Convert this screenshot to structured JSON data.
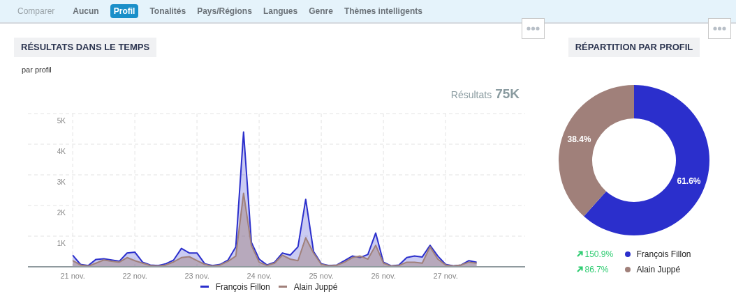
{
  "filter_bar": {
    "label": "Comparer",
    "tabs": [
      {
        "label": "Aucun",
        "selected": false
      },
      {
        "label": "Profil",
        "selected": true
      },
      {
        "label": "Tonalités",
        "selected": false
      },
      {
        "label": "Pays/Régions",
        "selected": false
      },
      {
        "label": "Langues",
        "selected": false
      },
      {
        "label": "Genre",
        "selected": false
      },
      {
        "label": "Thèmes intelligents",
        "selected": false
      }
    ]
  },
  "results_panel": {
    "title": "RÉSULTATS DANS LE TEMPS",
    "subtitle": "par profil",
    "total_label": "Résultats",
    "total_value": "75K",
    "chart_data": {
      "type": "area",
      "categories": [
        "21 nov.",
        null,
        null,
        null,
        null,
        null,
        null,
        null,
        "22 nov.",
        null,
        null,
        null,
        null,
        null,
        null,
        null,
        "23 nov.",
        null,
        null,
        null,
        null,
        null,
        null,
        null,
        "24 nov.",
        null,
        null,
        null,
        null,
        null,
        null,
        null,
        "25 nov.",
        null,
        null,
        null,
        null,
        null,
        null,
        null,
        "26 nov.",
        null,
        null,
        null,
        null,
        null,
        null,
        null,
        "27 nov.",
        null,
        null,
        null,
        null
      ],
      "series": [
        {
          "name": "François Fillon",
          "color": "#2b2fcc",
          "values": [
            380,
            80,
            40,
            240,
            260,
            220,
            180,
            450,
            480,
            150,
            60,
            40,
            100,
            220,
            600,
            450,
            450,
            100,
            40,
            80,
            220,
            650,
            4400,
            800,
            250,
            60,
            150,
            450,
            380,
            650,
            2200,
            500,
            100,
            40,
            60,
            200,
            350,
            300,
            400,
            1100,
            150,
            30,
            60,
            300,
            350,
            320,
            700,
            350,
            80,
            30,
            60,
            200,
            150
          ]
        },
        {
          "name": "Alain Juppé",
          "color": "#a0807a",
          "values": [
            200,
            60,
            20,
            120,
            220,
            180,
            150,
            300,
            200,
            120,
            40,
            20,
            60,
            160,
            300,
            330,
            200,
            80,
            20,
            60,
            180,
            350,
            2400,
            700,
            150,
            40,
            120,
            380,
            250,
            200,
            950,
            450,
            80,
            30,
            50,
            150,
            300,
            350,
            250,
            700,
            120,
            20,
            40,
            150,
            150,
            120,
            650,
            250,
            60,
            20,
            60,
            150,
            120
          ]
        }
      ],
      "grid": true,
      "ylim": [
        0,
        5000
      ],
      "yticks": [
        {
          "value": 1000,
          "label": "1K"
        },
        {
          "value": 2000,
          "label": "2K"
        },
        {
          "value": 3000,
          "label": "3K"
        },
        {
          "value": 4000,
          "label": "4K"
        },
        {
          "value": 5000,
          "label": "5K"
        }
      ]
    }
  },
  "profile_panel": {
    "title": "RÉPARTITION PAR PROFIL",
    "chart_data": {
      "type": "donut",
      "categories": [
        "François Fillon",
        "Alain Juppé"
      ],
      "values": [
        61.6,
        38.4
      ],
      "value_labels": [
        "61.6%",
        "38.4%"
      ]
    },
    "legend": [
      {
        "change": "150.9%",
        "color": "#2b2fcc"
      },
      {
        "change": "86.7%",
        "color": "#a0807a"
      }
    ]
  }
}
